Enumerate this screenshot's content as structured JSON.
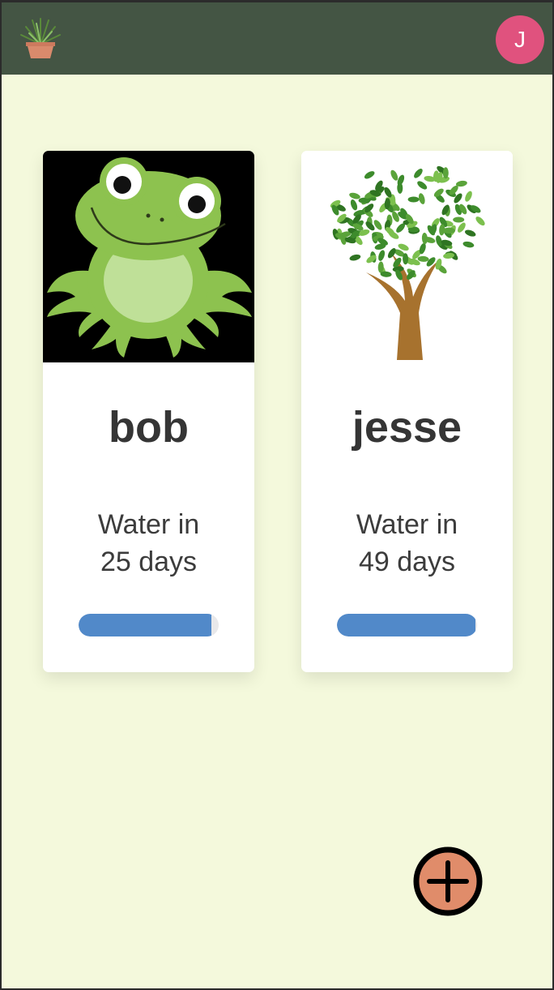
{
  "header": {
    "logo_icon": "potted-plant-icon",
    "avatar_initial": "J",
    "avatar_color": "#e0527e",
    "bar_color": "#445544"
  },
  "plants": [
    {
      "name": "bob",
      "water_line1": "Water in",
      "water_line2": "25 days",
      "progress": 0.95,
      "image_icon": "frog-image"
    },
    {
      "name": "jesse",
      "water_line1": "Water in",
      "water_line2": "49 days",
      "progress": 0.99,
      "image_icon": "tree-image"
    }
  ],
  "fab": {
    "icon": "plus-circle-icon",
    "color": "#e08c6a"
  },
  "colors": {
    "background": "#f4f9dc",
    "progress_fill": "#5189c9",
    "progress_track": "#e8e8ea"
  }
}
